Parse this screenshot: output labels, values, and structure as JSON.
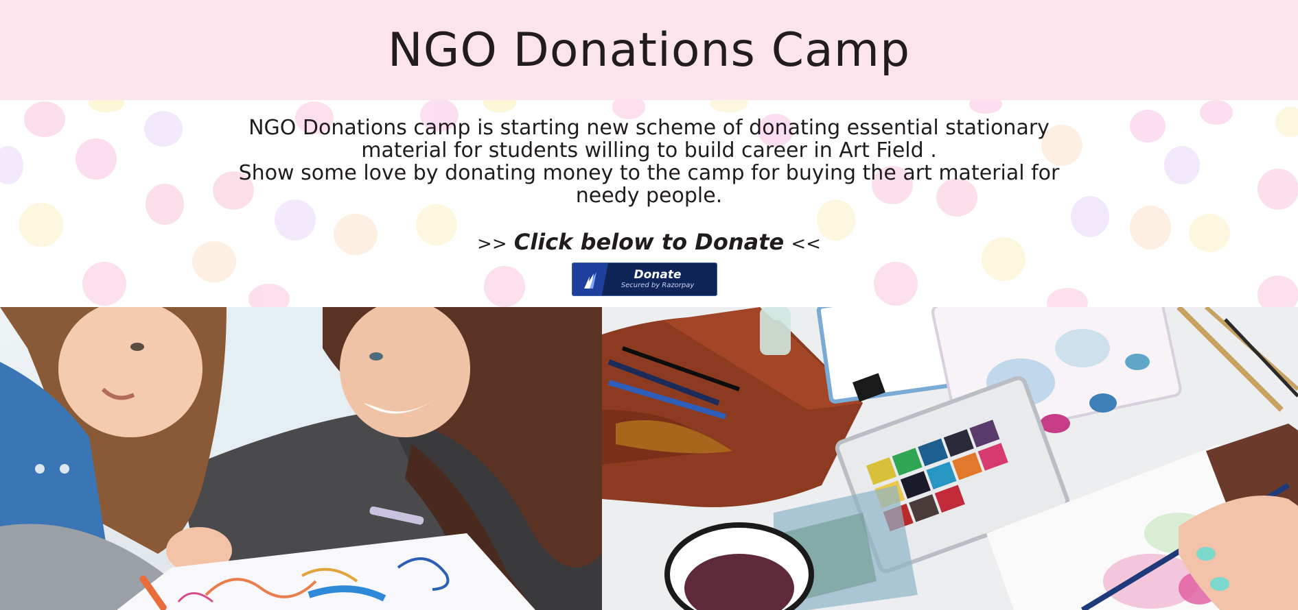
{
  "header": {
    "title": "NGO Donations Camp"
  },
  "hero": {
    "description_lines": [
      "NGO Donations camp is starting new scheme of donating essential stationary material for students willing to build career in Art Field .",
      "Show some love by donating money to the camp for buying the art material for needy people."
    ],
    "cta_prefix": ">>",
    "cta_text": "Click below to Donate",
    "cta_suffix": "<<"
  },
  "donate_button": {
    "label": "Donate",
    "sublabel": "Secured by Razorpay"
  },
  "colors": {
    "header_bg": "#fbe4ec",
    "button_bg": "#0f2558",
    "button_logo": "#1e3f9b"
  },
  "photos": [
    {
      "icon": "photo-child-drawing"
    },
    {
      "icon": "photo-watercolor-supplies"
    }
  ]
}
